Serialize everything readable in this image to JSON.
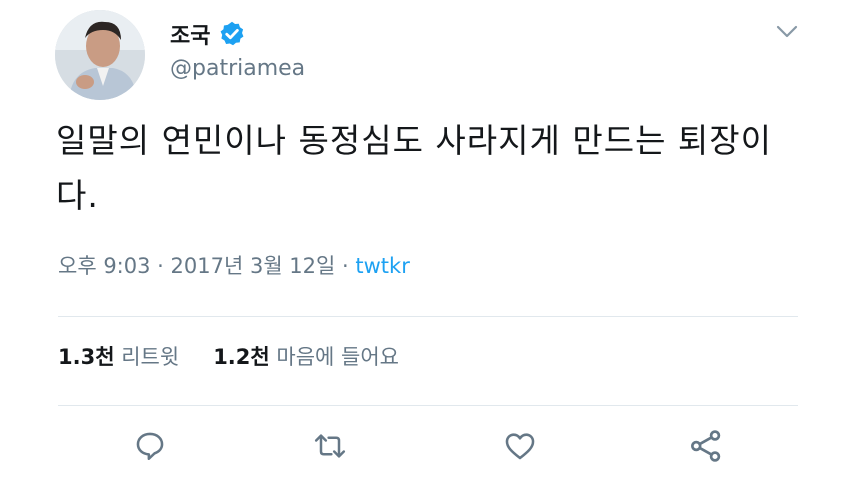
{
  "user": {
    "display_name": "조국",
    "handle": "@patriamea",
    "verified": true
  },
  "tweet": {
    "text": "일말의 연민이나 동정심도 사라지게 만드는 퇴장이다."
  },
  "meta": {
    "time": "오후 9:03",
    "date": "2017년 3월 12일",
    "separator": " · ",
    "source": "twtkr"
  },
  "stats": {
    "retweets_count": "1.3천",
    "retweets_label": "리트윗",
    "likes_count": "1.2천",
    "likes_label": "마음에 들어요"
  },
  "actions": {
    "reply_icon": "reply-icon",
    "retweet_icon": "retweet-icon",
    "like_icon": "heart-icon",
    "share_icon": "share-icon"
  },
  "colors": {
    "accent": "#1da1f2",
    "muted": "#657786",
    "text": "#14171a",
    "divider": "#e1e8ed"
  }
}
